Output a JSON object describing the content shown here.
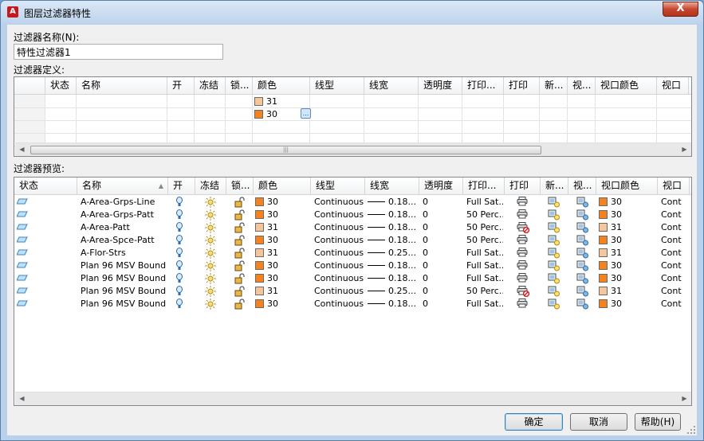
{
  "window": {
    "title": "图层过滤器特性",
    "close_label": "X"
  },
  "filter_name": {
    "label": "过滤器名称(N):",
    "value": "特性过滤器1"
  },
  "definition": {
    "label": "过滤器定义:",
    "columns": [
      "状态",
      "名称",
      "开",
      "冻结",
      "锁...",
      "颜色",
      "线型",
      "线宽",
      "透明度",
      "打印...",
      "打印",
      "新...",
      "视...",
      "视口颜色",
      "视口"
    ],
    "rows": [
      {
        "color_value": "31",
        "color_hex": "#f5c69a"
      },
      {
        "color_value": "30",
        "color_hex": "#f58220"
      }
    ]
  },
  "preview": {
    "label": "过滤器预览:",
    "columns": [
      "状态",
      "名称",
      "开",
      "冻结",
      "锁...",
      "颜色",
      "线型",
      "线宽",
      "透明度",
      "打印...",
      "打印",
      "新...",
      "视...",
      "视口颜色",
      "视口"
    ],
    "rows": [
      {
        "name": "A-Area-Grps-Line",
        "color": "30",
        "color_hex": "#f58220",
        "linetype": "Continuous",
        "lineweight": "0.18...",
        "transparency": "0",
        "plot_style": "Full Sat...",
        "plot_disabled": false,
        "vp_color": "30",
        "vp_hex": "#f58220",
        "vp": "Cont"
      },
      {
        "name": "A-Area-Grps-Patt",
        "color": "30",
        "color_hex": "#f58220",
        "linetype": "Continuous",
        "lineweight": "0.18...",
        "transparency": "0",
        "plot_style": "50 Perc...",
        "plot_disabled": false,
        "vp_color": "30",
        "vp_hex": "#f58220",
        "vp": "Cont"
      },
      {
        "name": "A-Area-Patt",
        "color": "31",
        "color_hex": "#f5c69a",
        "linetype": "Continuous",
        "lineweight": "0.18...",
        "transparency": "0",
        "plot_style": "50 Perc...",
        "plot_disabled": true,
        "vp_color": "31",
        "vp_hex": "#f5c69a",
        "vp": "Cont"
      },
      {
        "name": "A-Area-Spce-Patt",
        "color": "30",
        "color_hex": "#f58220",
        "linetype": "Continuous",
        "lineweight": "0.18...",
        "transparency": "0",
        "plot_style": "50 Perc...",
        "plot_disabled": false,
        "vp_color": "30",
        "vp_hex": "#f58220",
        "vp": "Cont"
      },
      {
        "name": "A-Flor-Strs",
        "color": "31",
        "color_hex": "#f5c69a",
        "linetype": "Continuous",
        "lineweight": "0.25...",
        "transparency": "0",
        "plot_style": "Full Sat...",
        "plot_disabled": false,
        "vp_color": "31",
        "vp_hex": "#f5c69a",
        "vp": "Cont"
      },
      {
        "name": "Plan 96 MSV Bound...",
        "color": "30",
        "color_hex": "#f58220",
        "linetype": "Continuous",
        "lineweight": "0.18...",
        "transparency": "0",
        "plot_style": "Full Sat...",
        "plot_disabled": false,
        "vp_color": "30",
        "vp_hex": "#f58220",
        "vp": "Cont"
      },
      {
        "name": "Plan 96 MSV Bound...",
        "color": "30",
        "color_hex": "#f58220",
        "linetype": "Continuous",
        "lineweight": "0.18...",
        "transparency": "0",
        "plot_style": "Full Sat...",
        "plot_disabled": false,
        "vp_color": "30",
        "vp_hex": "#f58220",
        "vp": "Cont"
      },
      {
        "name": "Plan 96 MSV Bound...",
        "color": "31",
        "color_hex": "#f5c69a",
        "linetype": "Continuous",
        "lineweight": "0.25...",
        "transparency": "0",
        "plot_style": "50 Perc...",
        "plot_disabled": true,
        "vp_color": "31",
        "vp_hex": "#f5c69a",
        "vp": "Cont"
      },
      {
        "name": "Plan 96 MSV Bound...",
        "color": "30",
        "color_hex": "#f58220",
        "linetype": "Continuous",
        "lineweight": "0.18...",
        "transparency": "0",
        "plot_style": "Full Sat...",
        "plot_disabled": false,
        "vp_color": "30",
        "vp_hex": "#f58220",
        "vp": "Cont"
      }
    ]
  },
  "buttons": {
    "ok": "确定",
    "cancel": "取消",
    "help": "帮助(H)"
  }
}
